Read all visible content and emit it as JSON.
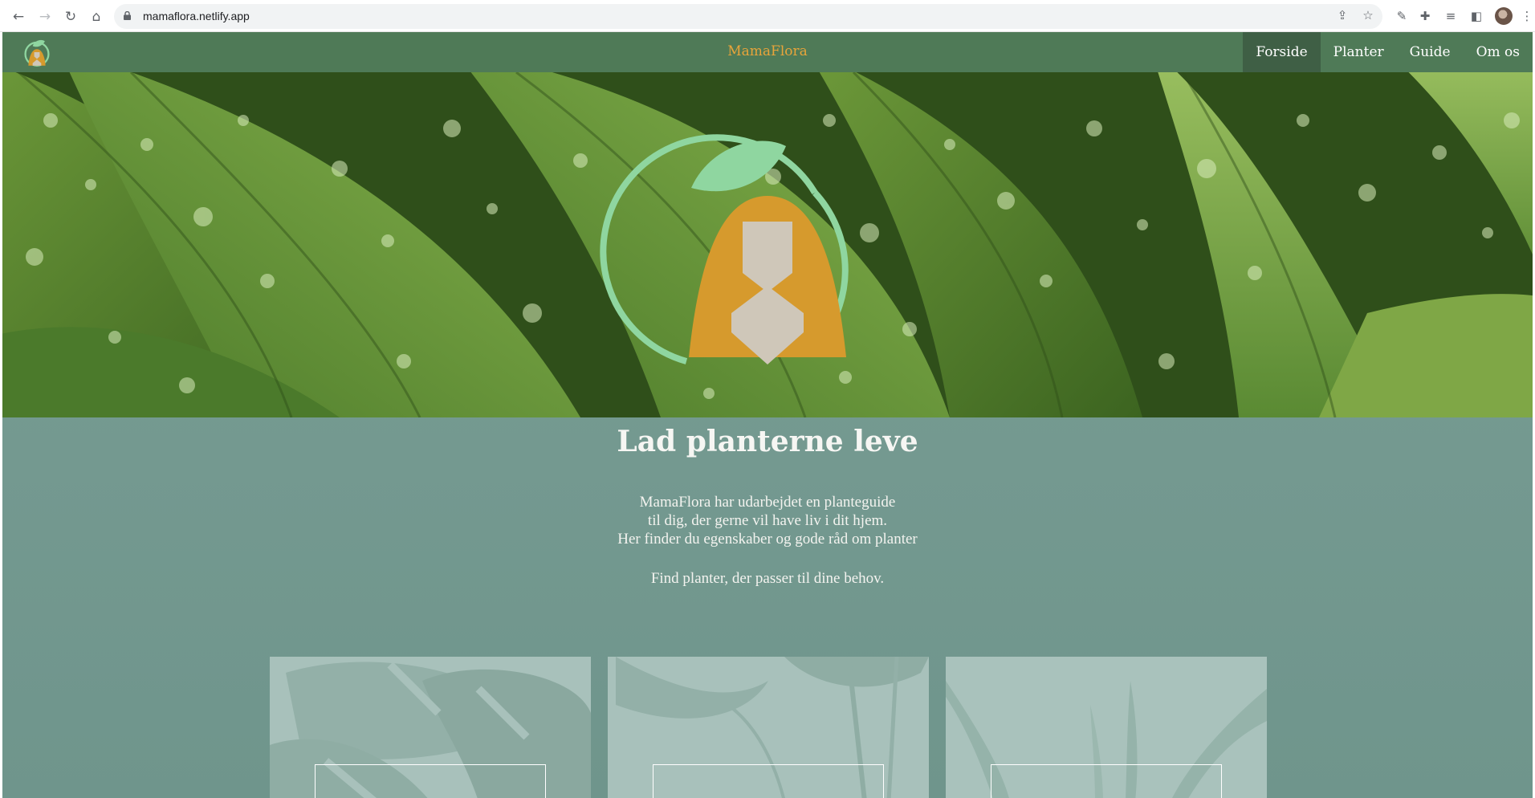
{
  "browser": {
    "url": "mamaflora.netlify.app",
    "icons": {
      "back": "back-arrow-icon",
      "forward": "forward-arrow-icon",
      "reload": "reload-icon",
      "home": "home-icon",
      "lock": "lock-icon",
      "share": "share-icon",
      "bookmark": "star-icon",
      "eyedropper": "eyedropper-icon",
      "extensions": "puzzle-icon",
      "reading_list": "reading-list-icon",
      "side_panel": "side-panel-icon",
      "menu": "more-vert-icon"
    }
  },
  "site": {
    "brand": "MamaFlora",
    "nav": [
      {
        "label": "Forside",
        "active": true
      },
      {
        "label": "Planter",
        "active": false
      },
      {
        "label": "Guide",
        "active": false
      },
      {
        "label": "Om os",
        "active": false
      }
    ]
  },
  "main": {
    "heading": "Lad planterne leve",
    "intro_lines": [
      "MamaFlora har udarbejdet en planteguide",
      "til dig, der gerne vil have liv i dit hjem.",
      "Her finder du egenskaber og gode råd om planter"
    ],
    "find_text": "Find planter, der passer til dine behov."
  },
  "colors": {
    "navbar": "#4f7a57",
    "nav_active": "#3f5f45",
    "brand": "#e8a43a",
    "page_bg": "#7a9e95",
    "logo_ring": "#8fd6a0",
    "logo_hair": "#d69a2d",
    "logo_skin": "#cfc7b9"
  }
}
